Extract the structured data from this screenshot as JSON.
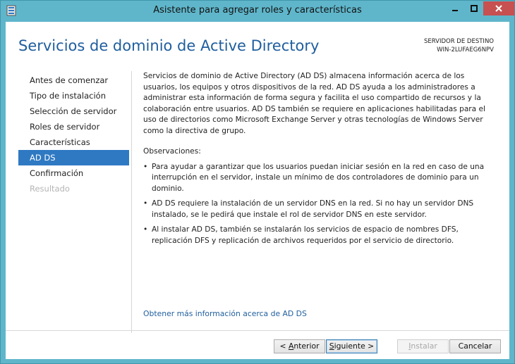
{
  "window": {
    "title": "Asistente para agregar roles y características"
  },
  "header": {
    "title": "Servicios de dominio de Active Directory",
    "dest_label": "SERVIDOR DE DESTINO",
    "dest_name": "WIN-2LUFAEG6NPV"
  },
  "nav": {
    "items": [
      {
        "label": "Antes de comenzar"
      },
      {
        "label": "Tipo de instalación"
      },
      {
        "label": "Selección de servidor"
      },
      {
        "label": "Roles de servidor"
      },
      {
        "label": "Características"
      },
      {
        "label": "AD DS"
      },
      {
        "label": "Confirmación"
      },
      {
        "label": "Resultado"
      }
    ]
  },
  "content": {
    "description": "Servicios de dominio de Active Directory (AD DS) almacena información acerca de los usuarios, los equipos y otros dispositivos de la red. AD DS ayuda a los administradores a administrar esta información de forma segura y facilita el uso compartido de recursos y la colaboración entre usuarios. AD DS también se requiere en aplicaciones habilitadas para el uso de directorios como Microsoft Exchange Server y otras tecnologías de Windows Server como la directiva de grupo.",
    "observations_label": "Observaciones:",
    "bullets": [
      "Para ayudar a garantizar que los usuarios puedan iniciar sesión en la red en caso de una interrupción en el servidor, instale un mínimo de dos controladores de dominio para un dominio.",
      "AD DS requiere la instalación de un servidor DNS en la red. Si no hay un servidor DNS instalado, se le pedirá que instale el rol de servidor DNS en este servidor.",
      "Al instalar AD DS, también se instalarán los servicios de espacio de nombres DFS, replicación DFS y replicación de archivos requeridos por el servicio de directorio."
    ],
    "link": "Obtener más información acerca de AD DS"
  },
  "buttons": {
    "back_prefix": "< ",
    "back_hotkey": "A",
    "back_rest": "nterior",
    "next_hotkey": "S",
    "next_rest": "iguiente >",
    "install_hotkey": "I",
    "install_rest": "nstalar",
    "cancel": "Cancelar"
  },
  "colors": {
    "frame": "#5fb6cb",
    "accent": "#2f79c3",
    "close": "#c75050",
    "title_text": "#1f5e9e"
  }
}
